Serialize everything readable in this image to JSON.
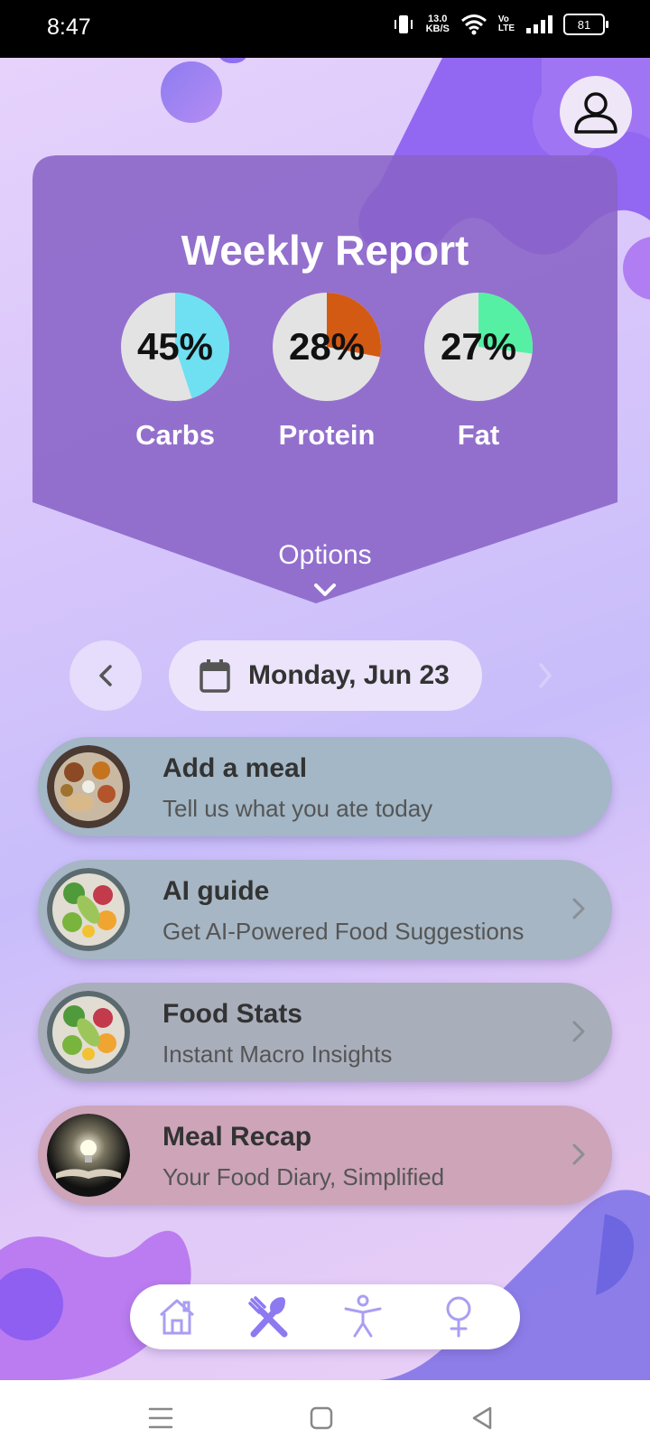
{
  "status_bar": {
    "time": "8:47",
    "net_speed_value": "13.0",
    "net_speed_unit": "KB/S",
    "volte_top": "Vo",
    "volte_bottom": "LTE",
    "battery": "81"
  },
  "weekly_report": {
    "title": "Weekly Report",
    "macros": [
      {
        "label": "Carbs",
        "percent_text": "45%",
        "fraction": 0.45,
        "color": "#6fe0f2"
      },
      {
        "label": "Protein",
        "percent_text": "28%",
        "fraction": 0.28,
        "color": "#d35a13"
      },
      {
        "label": "Fat",
        "percent_text": "27%",
        "fraction": 0.27,
        "color": "#55f0a4"
      }
    ],
    "options_label": "Options"
  },
  "date_nav": {
    "date": "Monday, Jun 23"
  },
  "cards": [
    {
      "title": "Add a meal",
      "subtitle": "Tell us what you ate today",
      "color": "#a3b7c6"
    },
    {
      "title": "AI guide",
      "subtitle": "Get AI-Powered Food Suggestions",
      "color": "#a6b6c4"
    },
    {
      "title": "Food Stats",
      "subtitle": "Instant Macro Insights",
      "color": "#a9aebb"
    },
    {
      "title": "Meal Recap",
      "subtitle": "Your Food Diary, Simplified",
      "color": "#cda4b8"
    }
  ],
  "bottom_nav": {
    "items": [
      "home-icon",
      "utensils-icon",
      "fitness-icon",
      "female-icon"
    ],
    "active_index": 1,
    "accent": "#8d7af0"
  },
  "theme": {
    "panel": "#8f6cc9",
    "accent_purple": "#8a5cf0"
  }
}
